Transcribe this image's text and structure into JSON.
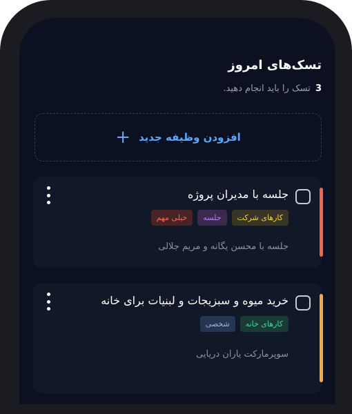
{
  "header": {
    "title": "تسک‌های امروز",
    "subtitle_count": "3",
    "subtitle_text": "تسک را باید انجام دهید."
  },
  "add_task": {
    "label": "افزودن وظیفه جدید",
    "icon": "plus-icon"
  },
  "tasks": [
    {
      "title": "جلسه با مدیران پروژه",
      "tags": [
        "کارهای شرکت",
        "جلسه",
        "خیلی مهم"
      ],
      "description": "جلسه با محسن یگانه و مریم جلالی",
      "priority_color": "#f0664a",
      "completed": false
    },
    {
      "title": "خرید میوه و سبزیجات و لبنیات برای خانه",
      "tags": [
        "کارهای خانه",
        "شخصی"
      ],
      "description": "سوپرمارکت یاران دریایی",
      "priority_color": "#f4a742",
      "completed": false
    }
  ],
  "colors": {
    "background": "#0b1120",
    "card": "#111827",
    "accent_blue": "#60a5fa"
  }
}
